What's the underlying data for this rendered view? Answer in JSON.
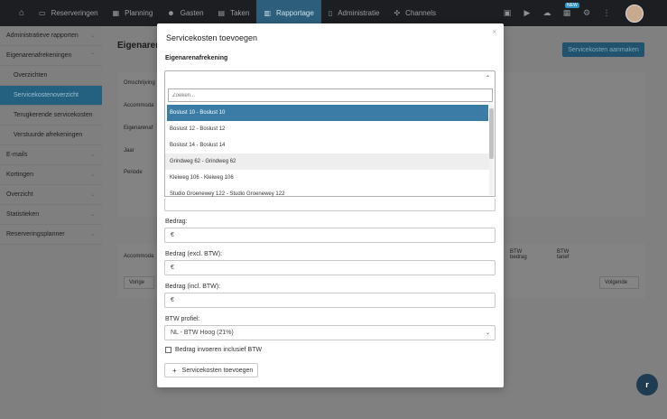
{
  "nav": {
    "items": [
      {
        "label": "Reserveringen",
        "icon": "monitor-icon"
      },
      {
        "label": "Planning",
        "icon": "grid-icon"
      },
      {
        "label": "Gasten",
        "icon": "users-icon"
      },
      {
        "label": "Taken",
        "icon": "clipboard-icon"
      },
      {
        "label": "Rapportage",
        "icon": "chart-icon"
      },
      {
        "label": "Administratie",
        "icon": "document-icon"
      },
      {
        "label": "Channels",
        "icon": "channels-icon"
      }
    ],
    "active": "Rapportage",
    "badge": "NEW"
  },
  "sidebar": {
    "items": [
      {
        "label": "Administratieve rapporten",
        "sub": false
      },
      {
        "label": "Eigenarenafrekeningen",
        "sub": false
      },
      {
        "label": "Overzichten",
        "sub": true
      },
      {
        "label": "Servicekostenoverzicht",
        "sub": true
      },
      {
        "label": "Terugkerende servicekosten",
        "sub": true
      },
      {
        "label": "Verstuurde afrekeningen",
        "sub": true
      },
      {
        "label": "E-mails",
        "sub": false
      },
      {
        "label": "Kortingen",
        "sub": false
      },
      {
        "label": "Overzicht",
        "sub": false
      },
      {
        "label": "Statistieken",
        "sub": false
      },
      {
        "label": "Reserveringsplanner",
        "sub": false
      }
    ]
  },
  "background": {
    "title": "Eigenarena",
    "create_button": "Servicekosten aanmaken",
    "labels": [
      "Omschrijving",
      "Accommoda",
      "Eigenarenaf",
      "Jaar",
      "Periode"
    ],
    "table_head": [
      "Accommoda",
      "BTW bedrag",
      "BTW tarief"
    ],
    "prev_button": "Vorige",
    "next_button": "Volgende"
  },
  "modal": {
    "title": "Servicekosten toevoegen",
    "close": "×",
    "owner_label": "Eigenarenafrekening",
    "search_placeholder": "Zoeken...",
    "options": [
      "Boslust 10 - Boslust 10",
      "Boslust 12 - Boslust 12",
      "Boslust 14 - Boslust 14",
      "Grindweg 62 - Grindweg 62",
      "Kleiweg 106 - Kleiweg 106",
      "Studio Groenewey 122 - Studio Groenewey 122"
    ],
    "amount_label": "Bedrag:",
    "amount_excl_label": "Bedrag (excl. BTW):",
    "amount_incl_label": "Bedrag (incl. BTW):",
    "currency": "€",
    "vat_profile_label": "BTW profiel:",
    "vat_profile_value": "NL - BTW Hoog (21%)",
    "checkbox_label": "Bedrag invoeren inclusief BTW",
    "add_button": "Servicekosten toevoegen"
  },
  "colors": {
    "accent": "#3a7ca5",
    "nav_active": "#2d5f7d",
    "topbar": "#1c1e21"
  }
}
